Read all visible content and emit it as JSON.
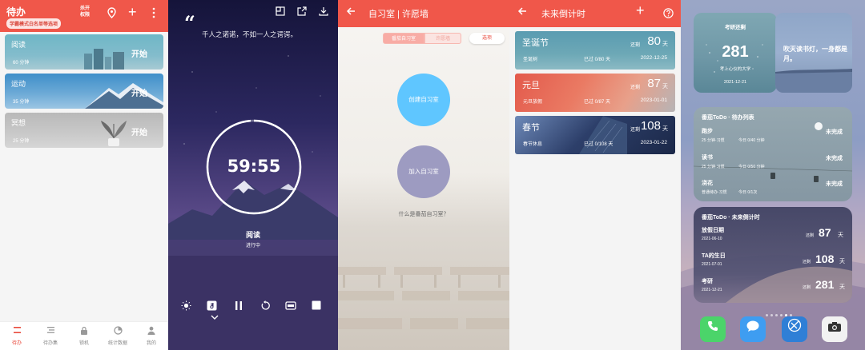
{
  "focus": {
    "title": "待办",
    "mode_badge": "学霸模式白名单等选项",
    "lock_label": "杀开\n权限",
    "items": [
      {
        "name": "阅读",
        "duration": "60 分钟",
        "start": "开始"
      },
      {
        "name": "运动",
        "duration": "35 分钟",
        "start": "开始"
      },
      {
        "name": "冥想",
        "duration": "25 分钟",
        "start": "开始"
      }
    ],
    "nav": [
      {
        "label": "待办",
        "icon": "list-icon"
      },
      {
        "label": "待办集",
        "icon": "collection-icon"
      },
      {
        "label": "锁机",
        "icon": "lock-icon"
      },
      {
        "label": "统计数据",
        "icon": "pie-chart-icon"
      },
      {
        "label": "我的",
        "icon": "user-icon"
      }
    ]
  },
  "timer": {
    "quote_mark": "“",
    "quote": "千人之诺诺，不如一人之谔谔。",
    "time": "59:55",
    "task": "阅读",
    "status": "进行中"
  },
  "study_room": {
    "title": "自习室 | 许愿墙",
    "segments": [
      "番茄自习室",
      "许愿墙"
    ],
    "options": "选项",
    "create": "创建自习室",
    "join": "加入自习室",
    "what": "什么是番茄自习室？"
  },
  "countdown": {
    "title": "未来倒计时",
    "items": [
      {
        "name": "圣诞节",
        "sub": "圣诞树",
        "passed": "已过 0/80 天",
        "date": "2022-12-25",
        "left": "还剩",
        "days": "80",
        "unit": "天"
      },
      {
        "name": "元旦",
        "sub": "元旦放假",
        "passed": "已过 0/87 天",
        "date": "2023-01-01",
        "left": "还剩",
        "days": "87",
        "unit": "天"
      },
      {
        "name": "春节",
        "sub": "春节休息",
        "passed": "已过 0/108 天",
        "date": "2023-01-22",
        "left": "还剩",
        "days": "108",
        "unit": "天"
      }
    ]
  },
  "home": {
    "exam": {
      "title": "考研还剩",
      "days": "281",
      "school": "考上心仪的大学",
      "date": "2021-12-21"
    },
    "quote": "吹灭读书灯，一身都是月。",
    "todo": {
      "title": "番茄ToDo · 待办列表",
      "items": [
        {
          "name": "跑步",
          "meta1": "25 分钟·习惯",
          "meta2": "今日 0/40 分钟",
          "status": "未完成"
        },
        {
          "name": "读书",
          "meta1": "25 分钟·习惯",
          "meta2": "今日 0/50 分钟",
          "status": "未完成"
        },
        {
          "name": "浇花",
          "meta1": "普通待办·习惯",
          "meta2": "今日 0/1次",
          "status": "未完成"
        }
      ]
    },
    "countdown": {
      "title": "番茄ToDo · 未来倒计时",
      "items": [
        {
          "name": "放假日期",
          "date": "2021-06-10",
          "left": "还剩",
          "days": "87",
          "unit": "天"
        },
        {
          "name": "TA的生日",
          "date": "2021-07-01",
          "left": "还剩",
          "days": "108",
          "unit": "天"
        },
        {
          "name": "考研",
          "date": "2021-12-21",
          "left": "还剩",
          "days": "281",
          "unit": "天"
        }
      ]
    },
    "dock": [
      "phone-icon",
      "messages-icon",
      "browser-icon",
      "camera-icon"
    ]
  }
}
